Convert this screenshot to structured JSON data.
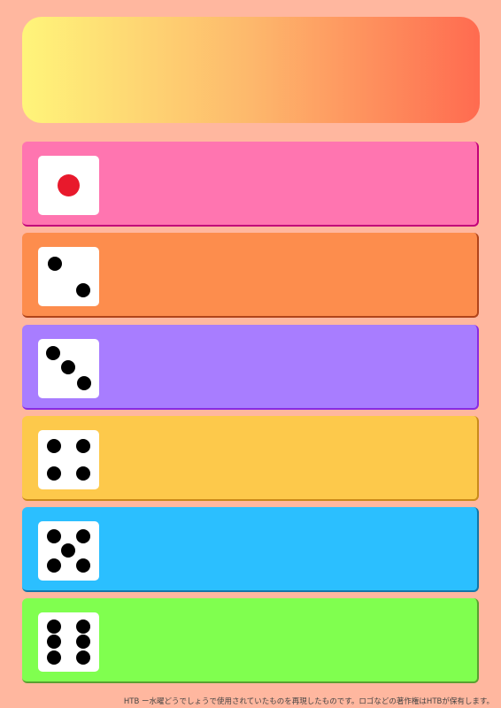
{
  "banner": {
    "gradient": [
      "#fff57a",
      "#fdb86c",
      "#ff6b50"
    ]
  },
  "rows": [
    {
      "die_value": 1,
      "color": "#ff75b0",
      "edge": "#c2007a",
      "pip_color": "#e8192c"
    },
    {
      "die_value": 2,
      "color": "#fd8d4d",
      "edge": "#b0441a",
      "pip_color": "#000000"
    },
    {
      "die_value": 3,
      "color": "#a87dff",
      "edge": "#8a2be2",
      "pip_color": "#000000"
    },
    {
      "die_value": 4,
      "color": "#fdc94b",
      "edge": "#c98a1a",
      "pip_color": "#000000"
    },
    {
      "die_value": 5,
      "color": "#2bbfff",
      "edge": "#1275a8",
      "pip_color": "#000000"
    },
    {
      "die_value": 6,
      "color": "#80ff4f",
      "edge": "#5aa030",
      "pip_color": "#000000"
    }
  ],
  "footer": {
    "credit": "HTB ー水曜どうでしょうで使用されていたものを再現したものです。ロゴなどの著作権はHTBが保有します。"
  }
}
